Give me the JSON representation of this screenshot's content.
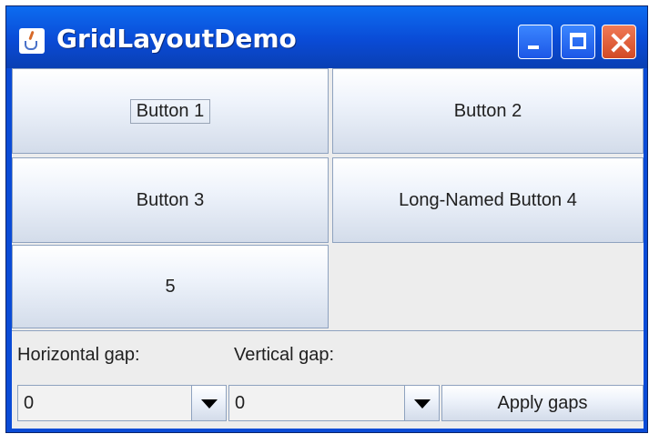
{
  "window": {
    "title": "GridLayoutDemo",
    "icon": "java-coffee-cup-icon",
    "controls": [
      "minimize-icon",
      "maximize-icon",
      "close-icon"
    ]
  },
  "grid": {
    "buttons": [
      {
        "label": "Button 1"
      },
      {
        "label": "Button 2"
      },
      {
        "label": "Button 3"
      },
      {
        "label": "Long-Named Button 4"
      },
      {
        "label": "5"
      }
    ]
  },
  "controls": {
    "horizontal_gap_label": "Horizontal gap:",
    "vertical_gap_label": "Vertical gap:",
    "horizontal_gap_value": "0",
    "vertical_gap_value": "0",
    "apply_label": "Apply gaps"
  },
  "colors": {
    "titlebar": "#0a4bd6",
    "panel": "#ededed",
    "button_border": "#8ea2bf"
  }
}
